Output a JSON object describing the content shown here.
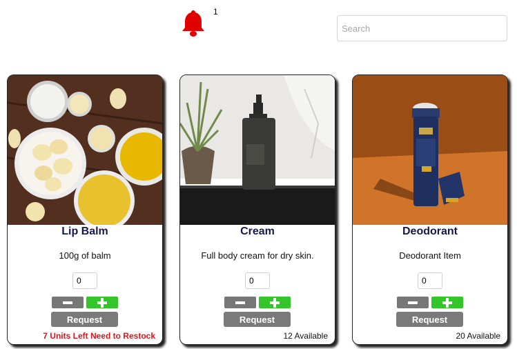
{
  "notifications": {
    "count": "1",
    "icon": "bell-icon",
    "color": "#e00000"
  },
  "search": {
    "placeholder": "Search",
    "value": ""
  },
  "products": [
    {
      "title": "Lip Balm",
      "description": "100g of balm",
      "quantity": "0",
      "request_label": "Request",
      "stock_text": "7 Units Left Need to Restock",
      "stock_status": "low"
    },
    {
      "title": "Cream",
      "description": "Full body cream for dry skin.",
      "quantity": "0",
      "request_label": "Request",
      "stock_text": "12 Available",
      "stock_status": "ok"
    },
    {
      "title": "Deodorant",
      "description": "Deodorant Item",
      "quantity": "0",
      "request_label": "Request",
      "stock_text": "20 Available",
      "stock_status": "ok"
    }
  ],
  "colors": {
    "title": "#15174d",
    "minus_button": "#777777",
    "plus_button": "#34c52a",
    "request_button": "#7a7a7a",
    "low_stock": "#e0141a"
  }
}
